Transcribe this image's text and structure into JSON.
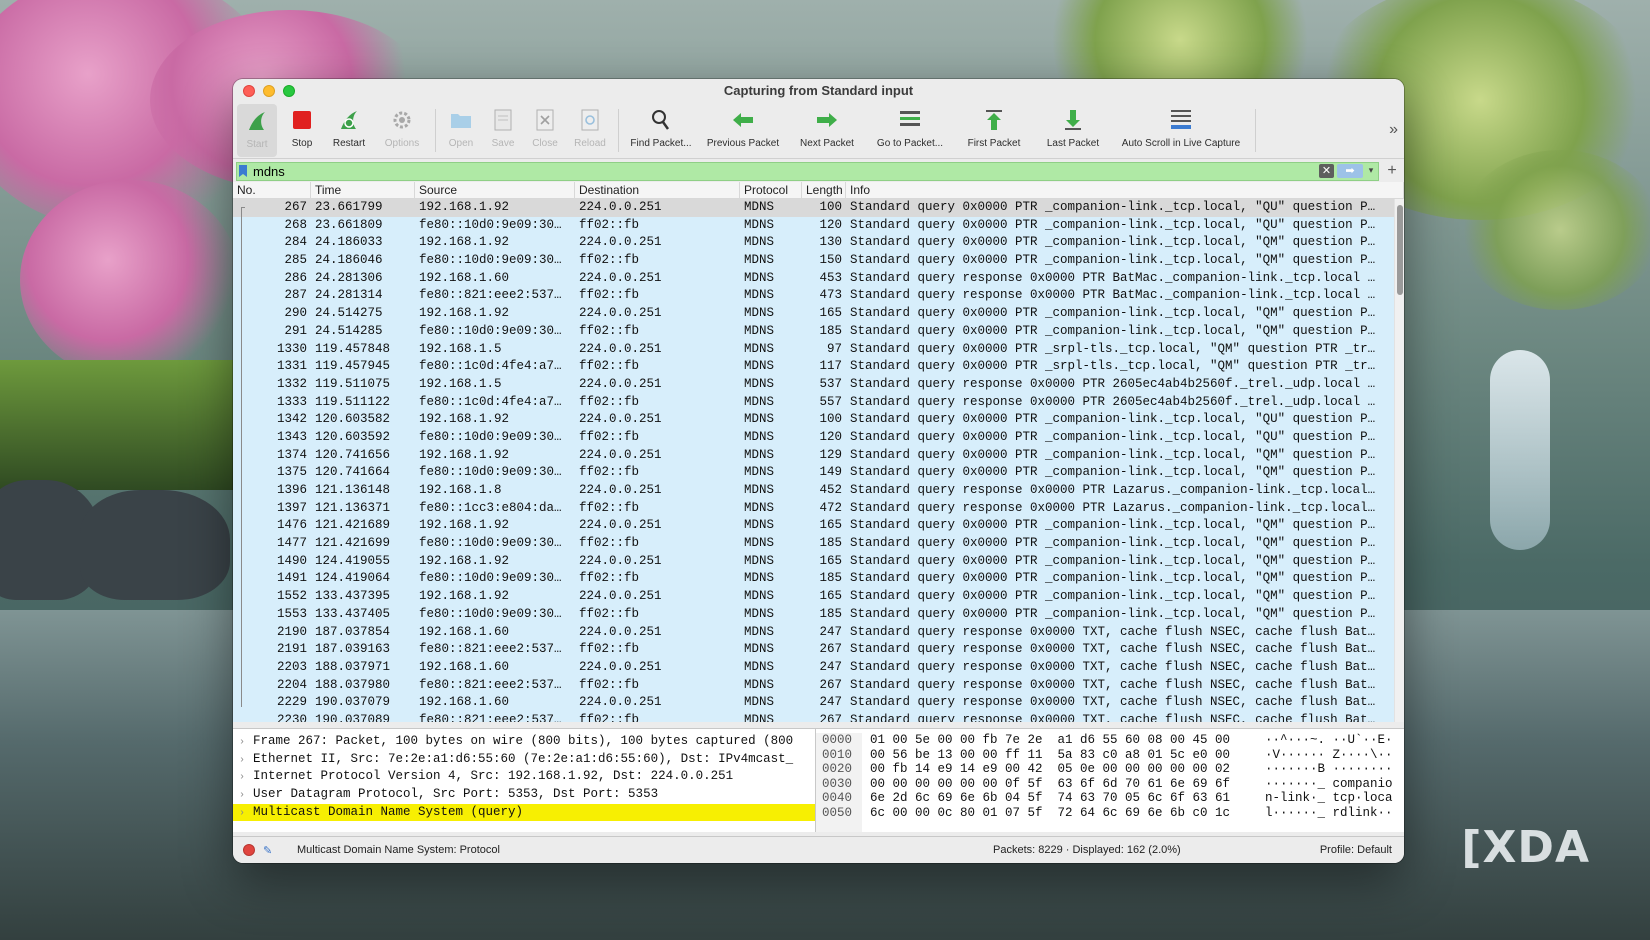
{
  "window": {
    "title": "Capturing from Standard input"
  },
  "toolbar": {
    "buttons": [
      {
        "label": "Start",
        "icon": "shark-fin-icon",
        "enabled": false
      },
      {
        "label": "Stop",
        "icon": "stop-square-icon",
        "enabled": true
      },
      {
        "label": "Restart",
        "icon": "restart-fin-icon",
        "enabled": true
      },
      {
        "label": "Options",
        "icon": "gear-icon",
        "enabled": false
      },
      {
        "label": "Open",
        "icon": "folder-icon",
        "enabled": false
      },
      {
        "label": "Save",
        "icon": "document-icon",
        "enabled": false
      },
      {
        "label": "Close",
        "icon": "close-file-icon",
        "enabled": false
      },
      {
        "label": "Reload",
        "icon": "reload-icon",
        "enabled": false
      },
      {
        "label": "Find Packet...",
        "icon": "magnifier-icon",
        "enabled": true
      },
      {
        "label": "Previous Packet",
        "icon": "arrow-left-icon",
        "enabled": true
      },
      {
        "label": "Next Packet",
        "icon": "arrow-right-icon",
        "enabled": true
      },
      {
        "label": "Go to Packet...",
        "icon": "goto-packet-icon",
        "enabled": true
      },
      {
        "label": "First Packet",
        "icon": "arrow-up-icon",
        "enabled": true
      },
      {
        "label": "Last Packet",
        "icon": "arrow-down-icon",
        "enabled": true
      },
      {
        "label": "Auto Scroll in Live Capture",
        "icon": "auto-scroll-icon",
        "enabled": true
      }
    ],
    "more": "»"
  },
  "filter": {
    "value": "mdns",
    "clear": "✕",
    "apply": "➡",
    "dropdown": "▾",
    "add": "+"
  },
  "columns": {
    "no": "No.",
    "time": "Time",
    "source": "Source",
    "destination": "Destination",
    "protocol": "Protocol",
    "length": "Length",
    "info": "Info"
  },
  "packets": [
    {
      "no": "267",
      "time": "23.661799",
      "src": "192.168.1.92",
      "dst": "224.0.0.251",
      "proto": "MDNS",
      "len": "100",
      "info": "Standard query 0x0000 PTR _companion-link._tcp.local, \"QU\" question P…"
    },
    {
      "no": "268",
      "time": "23.661809",
      "src": "fe80::10d0:9e09:30…",
      "dst": "ff02::fb",
      "proto": "MDNS",
      "len": "120",
      "info": "Standard query 0x0000 PTR _companion-link._tcp.local, \"QU\" question P…"
    },
    {
      "no": "284",
      "time": "24.186033",
      "src": "192.168.1.92",
      "dst": "224.0.0.251",
      "proto": "MDNS",
      "len": "130",
      "info": "Standard query 0x0000 PTR _companion-link._tcp.local, \"QM\" question P…"
    },
    {
      "no": "285",
      "time": "24.186046",
      "src": "fe80::10d0:9e09:30…",
      "dst": "ff02::fb",
      "proto": "MDNS",
      "len": "150",
      "info": "Standard query 0x0000 PTR _companion-link._tcp.local, \"QM\" question P…"
    },
    {
      "no": "286",
      "time": "24.281306",
      "src": "192.168.1.60",
      "dst": "224.0.0.251",
      "proto": "MDNS",
      "len": "453",
      "info": "Standard query response 0x0000 PTR BatMac._companion-link._tcp.local …"
    },
    {
      "no": "287",
      "time": "24.281314",
      "src": "fe80::821:eee2:537…",
      "dst": "ff02::fb",
      "proto": "MDNS",
      "len": "473",
      "info": "Standard query response 0x0000 PTR BatMac._companion-link._tcp.local …"
    },
    {
      "no": "290",
      "time": "24.514275",
      "src": "192.168.1.92",
      "dst": "224.0.0.251",
      "proto": "MDNS",
      "len": "165",
      "info": "Standard query 0x0000 PTR _companion-link._tcp.local, \"QM\" question P…"
    },
    {
      "no": "291",
      "time": "24.514285",
      "src": "fe80::10d0:9e09:30…",
      "dst": "ff02::fb",
      "proto": "MDNS",
      "len": "185",
      "info": "Standard query 0x0000 PTR _companion-link._tcp.local, \"QM\" question P…"
    },
    {
      "no": "1330",
      "time": "119.457848",
      "src": "192.168.1.5",
      "dst": "224.0.0.251",
      "proto": "MDNS",
      "len": "97",
      "info": "Standard query 0x0000 PTR _srpl-tls._tcp.local, \"QM\" question PTR _tr…"
    },
    {
      "no": "1331",
      "time": "119.457945",
      "src": "fe80::1c0d:4fe4:a7…",
      "dst": "ff02::fb",
      "proto": "MDNS",
      "len": "117",
      "info": "Standard query 0x0000 PTR _srpl-tls._tcp.local, \"QM\" question PTR _tr…"
    },
    {
      "no": "1332",
      "time": "119.511075",
      "src": "192.168.1.5",
      "dst": "224.0.0.251",
      "proto": "MDNS",
      "len": "537",
      "info": "Standard query response 0x0000 PTR 2605ec4ab4b2560f._trel._udp.local …"
    },
    {
      "no": "1333",
      "time": "119.511122",
      "src": "fe80::1c0d:4fe4:a7…",
      "dst": "ff02::fb",
      "proto": "MDNS",
      "len": "557",
      "info": "Standard query response 0x0000 PTR 2605ec4ab4b2560f._trel._udp.local …"
    },
    {
      "no": "1342",
      "time": "120.603582",
      "src": "192.168.1.92",
      "dst": "224.0.0.251",
      "proto": "MDNS",
      "len": "100",
      "info": "Standard query 0x0000 PTR _companion-link._tcp.local, \"QU\" question P…"
    },
    {
      "no": "1343",
      "time": "120.603592",
      "src": "fe80::10d0:9e09:30…",
      "dst": "ff02::fb",
      "proto": "MDNS",
      "len": "120",
      "info": "Standard query 0x0000 PTR _companion-link._tcp.local, \"QU\" question P…"
    },
    {
      "no": "1374",
      "time": "120.741656",
      "src": "192.168.1.92",
      "dst": "224.0.0.251",
      "proto": "MDNS",
      "len": "129",
      "info": "Standard query 0x0000 PTR _companion-link._tcp.local, \"QM\" question P…"
    },
    {
      "no": "1375",
      "time": "120.741664",
      "src": "fe80::10d0:9e09:30…",
      "dst": "ff02::fb",
      "proto": "MDNS",
      "len": "149",
      "info": "Standard query 0x0000 PTR _companion-link._tcp.local, \"QM\" question P…"
    },
    {
      "no": "1396",
      "time": "121.136148",
      "src": "192.168.1.8",
      "dst": "224.0.0.251",
      "proto": "MDNS",
      "len": "452",
      "info": "Standard query response 0x0000 PTR Lazarus._companion-link._tcp.local…"
    },
    {
      "no": "1397",
      "time": "121.136371",
      "src": "fe80::1cc3:e804:da…",
      "dst": "ff02::fb",
      "proto": "MDNS",
      "len": "472",
      "info": "Standard query response 0x0000 PTR Lazarus._companion-link._tcp.local…"
    },
    {
      "no": "1476",
      "time": "121.421689",
      "src": "192.168.1.92",
      "dst": "224.0.0.251",
      "proto": "MDNS",
      "len": "165",
      "info": "Standard query 0x0000 PTR _companion-link._tcp.local, \"QM\" question P…"
    },
    {
      "no": "1477",
      "time": "121.421699",
      "src": "fe80::10d0:9e09:30…",
      "dst": "ff02::fb",
      "proto": "MDNS",
      "len": "185",
      "info": "Standard query 0x0000 PTR _companion-link._tcp.local, \"QM\" question P…"
    },
    {
      "no": "1490",
      "time": "124.419055",
      "src": "192.168.1.92",
      "dst": "224.0.0.251",
      "proto": "MDNS",
      "len": "165",
      "info": "Standard query 0x0000 PTR _companion-link._tcp.local, \"QM\" question P…"
    },
    {
      "no": "1491",
      "time": "124.419064",
      "src": "fe80::10d0:9e09:30…",
      "dst": "ff02::fb",
      "proto": "MDNS",
      "len": "185",
      "info": "Standard query 0x0000 PTR _companion-link._tcp.local, \"QM\" question P…"
    },
    {
      "no": "1552",
      "time": "133.437395",
      "src": "192.168.1.92",
      "dst": "224.0.0.251",
      "proto": "MDNS",
      "len": "165",
      "info": "Standard query 0x0000 PTR _companion-link._tcp.local, \"QM\" question P…"
    },
    {
      "no": "1553",
      "time": "133.437405",
      "src": "fe80::10d0:9e09:30…",
      "dst": "ff02::fb",
      "proto": "MDNS",
      "len": "185",
      "info": "Standard query 0x0000 PTR _companion-link._tcp.local, \"QM\" question P…"
    },
    {
      "no": "2190",
      "time": "187.037854",
      "src": "192.168.1.60",
      "dst": "224.0.0.251",
      "proto": "MDNS",
      "len": "247",
      "info": "Standard query response 0x0000 TXT, cache flush NSEC, cache flush Bat…"
    },
    {
      "no": "2191",
      "time": "187.039163",
      "src": "fe80::821:eee2:537…",
      "dst": "ff02::fb",
      "proto": "MDNS",
      "len": "267",
      "info": "Standard query response 0x0000 TXT, cache flush NSEC, cache flush Bat…"
    },
    {
      "no": "2203",
      "time": "188.037971",
      "src": "192.168.1.60",
      "dst": "224.0.0.251",
      "proto": "MDNS",
      "len": "247",
      "info": "Standard query response 0x0000 TXT, cache flush NSEC, cache flush Bat…"
    },
    {
      "no": "2204",
      "time": "188.037980",
      "src": "fe80::821:eee2:537…",
      "dst": "ff02::fb",
      "proto": "MDNS",
      "len": "267",
      "info": "Standard query response 0x0000 TXT, cache flush NSEC, cache flush Bat…"
    },
    {
      "no": "2229",
      "time": "190.037079",
      "src": "192.168.1.60",
      "dst": "224.0.0.251",
      "proto": "MDNS",
      "len": "247",
      "info": "Standard query response 0x0000 TXT, cache flush NSEC, cache flush Bat…"
    },
    {
      "no": "2230",
      "time": "190.037089",
      "src": "fe80::821:eee2:537…",
      "dst": "ff02::fb",
      "proto": "MDNS",
      "len": "267",
      "info": "Standard query response 0x0000 TXT, cache flush NSEC, cache flush Bat…"
    }
  ],
  "details": [
    "Frame 267: Packet, 100 bytes on wire (800 bits), 100 bytes captured (800",
    "Ethernet II, Src: 7e:2e:a1:d6:55:60 (7e:2e:a1:d6:55:60), Dst: IPv4mcast_",
    "Internet Protocol Version 4, Src: 192.168.1.92, Dst: 224.0.0.251",
    "User Datagram Protocol, Src Port: 5353, Dst Port: 5353",
    "Multicast Domain Name System (query)"
  ],
  "bytes": {
    "offsets": [
      "0000",
      "0010",
      "0020",
      "0030",
      "0040",
      "0050"
    ],
    "hex": [
      "01 00 5e 00 00 fb 7e 2e  a1 d6 55 60 08 00 45 00",
      "00 56 be 13 00 00 ff 11  5a 83 c0 a8 01 5c e0 00",
      "00 fb 14 e9 14 e9 00 42  05 0e 00 00 00 00 00 02",
      "00 00 00 00 00 00 0f 5f  63 6f 6d 70 61 6e 69 6f",
      "6e 2d 6c 69 6e 6b 04 5f  74 63 70 05 6c 6f 63 61",
      "6c 00 00 0c 80 01 07 5f  72 64 6c 69 6e 6b c0 1c"
    ],
    "ascii": [
      "··^···~. ··U`··E·",
      "·V······ Z····\\··",
      "·······B ········",
      "·······_ companio",
      "n-link·_ tcp·loca",
      "l······_ rdlink··"
    ]
  },
  "status": {
    "protocol_text": "Multicast Domain Name System: Protocol",
    "counts": "Packets: 8229 · Displayed: 162 (2.0%)",
    "profile": "Profile: Default"
  },
  "watermark": "XDA"
}
